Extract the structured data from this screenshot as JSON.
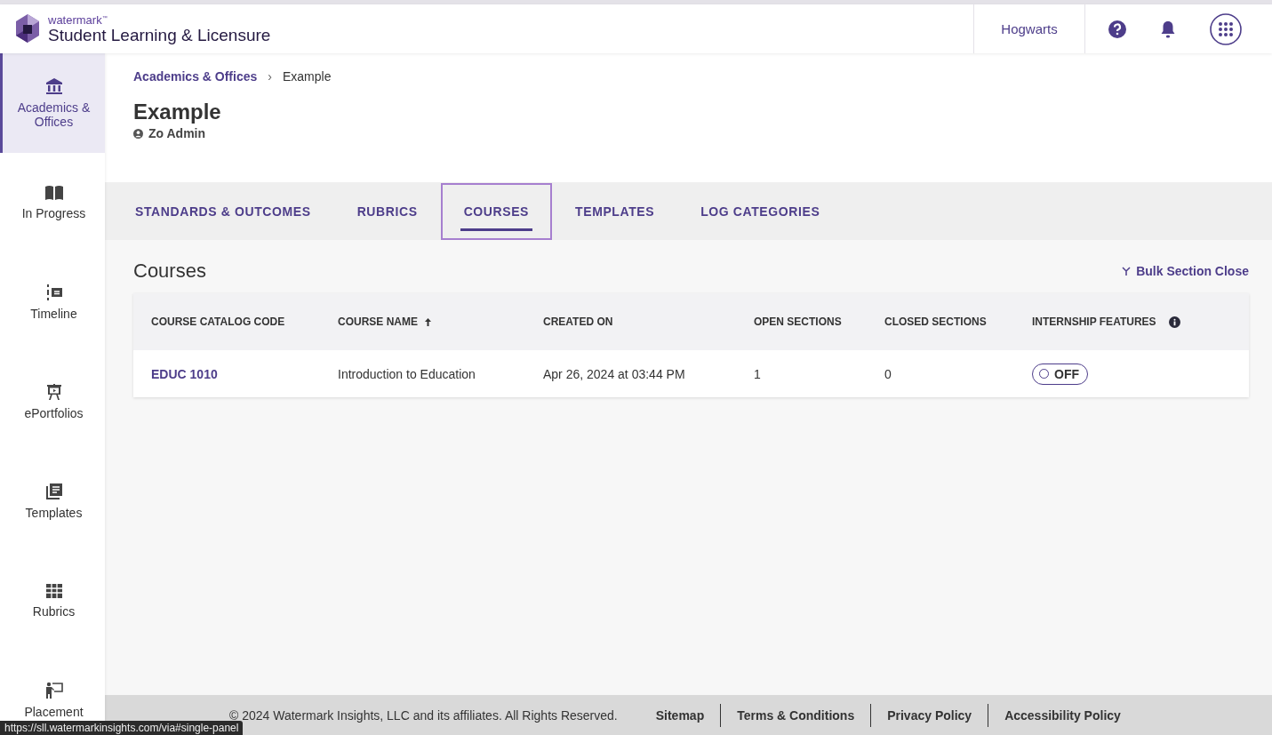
{
  "header": {
    "brand_small": "watermark",
    "brand_tm": "™",
    "product": "Student Learning & Licensure",
    "institution": "Hogwarts"
  },
  "sidebar": {
    "items": [
      {
        "label": "Academics & Offices",
        "selected": true
      },
      {
        "label": "In Progress",
        "selected": false
      },
      {
        "label": "Timeline",
        "selected": false
      },
      {
        "label": "ePortfolios",
        "selected": false
      },
      {
        "label": "Templates",
        "selected": false
      },
      {
        "label": "Rubrics",
        "selected": false
      },
      {
        "label": "Placement",
        "selected": false
      }
    ]
  },
  "breadcrumb": {
    "items": [
      "Academics & Offices",
      "Example"
    ],
    "separator": "›"
  },
  "page": {
    "title": "Example",
    "owner": "Zo Admin"
  },
  "tabs": [
    {
      "label": "STANDARDS & OUTCOMES",
      "selected": false
    },
    {
      "label": "RUBRICS",
      "selected": false
    },
    {
      "label": "COURSES",
      "selected": true
    },
    {
      "label": "TEMPLATES",
      "selected": false
    },
    {
      "label": "LOG CATEGORIES",
      "selected": false
    }
  ],
  "section": {
    "title": "Courses",
    "action": "Bulk Section Close"
  },
  "table": {
    "columns": [
      "COURSE CATALOG CODE",
      "COURSE NAME",
      "CREATED ON",
      "OPEN SECTIONS",
      "CLOSED SECTIONS",
      "INTERNSHIP FEATURES"
    ],
    "rows": [
      {
        "code": "EDUC 1010",
        "name": "Introduction to Education",
        "created": "Apr 26, 2024 at 03:44 PM",
        "open": "1",
        "closed": "0",
        "internship": {
          "on": false,
          "label": "OFF"
        }
      }
    ]
  },
  "footer": {
    "copyright": "© 2024 Watermark Insights, LLC and its affiliates. All Rights Reserved.",
    "links": [
      "Sitemap",
      "Terms & Conditions",
      "Privacy Policy",
      "Accessibility Policy"
    ]
  },
  "status_url": "https://sll.watermarkinsights.com/via#single-panel"
}
